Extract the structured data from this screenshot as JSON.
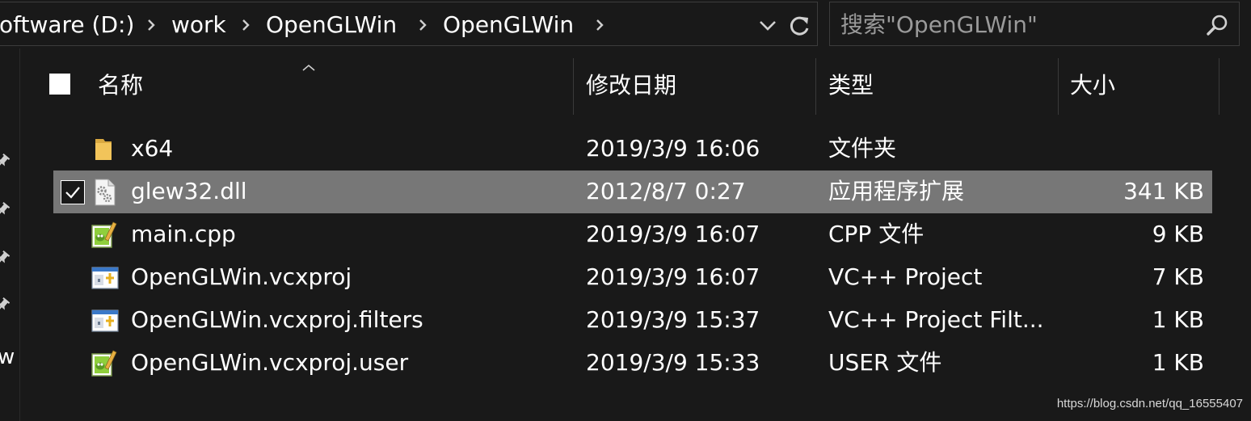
{
  "address_bar": {
    "breadcrumbs": [
      {
        "label": "oftware (D:)"
      },
      {
        "label": "work"
      },
      {
        "label": "OpenGLWin"
      },
      {
        "label": "OpenGLWin"
      }
    ],
    "dropdown_icon": "chevron-down-icon",
    "refresh_icon": "refresh-icon"
  },
  "search": {
    "placeholder": "搜索\"OpenGLWin\"",
    "icon": "search-icon"
  },
  "nav_pane": {
    "partial_label": "w",
    "pin_icons": [
      "pin-icon",
      "pin-icon",
      "pin-icon",
      "pin-icon"
    ]
  },
  "file_list": {
    "columns": {
      "name": "名称",
      "modified": "修改日期",
      "type": "类型",
      "size": "大小"
    },
    "sort_indicator": "sort-up-icon",
    "rows": [
      {
        "name": "x64",
        "modified": "2019/3/9 16:06",
        "type": "文件夹",
        "size": "",
        "icon": "folder-icon",
        "selected": false
      },
      {
        "name": "glew32.dll",
        "modified": "2012/8/7 0:27",
        "type": "应用程序扩展",
        "size": "341 KB",
        "icon": "dll-file-icon",
        "selected": true
      },
      {
        "name": "main.cpp",
        "modified": "2019/3/9 16:07",
        "type": "CPP 文件",
        "size": "9 KB",
        "icon": "notepadpp-file-icon",
        "selected": false
      },
      {
        "name": "OpenGLWin.vcxproj",
        "modified": "2019/3/9 16:07",
        "type": "VC++ Project",
        "size": "7 KB",
        "icon": "vcxproj-file-icon",
        "selected": false
      },
      {
        "name": "OpenGLWin.vcxproj.filters",
        "modified": "2019/3/9 15:37",
        "type": "VC++ Project Filt...",
        "size": "1 KB",
        "icon": "vcxproj-file-icon",
        "selected": false
      },
      {
        "name": "OpenGLWin.vcxproj.user",
        "modified": "2019/3/9 15:33",
        "type": "USER 文件",
        "size": "1 KB",
        "icon": "notepadpp-file-icon",
        "selected": false
      }
    ]
  },
  "watermark": "https://blog.csdn.net/qq_16555407",
  "colors": {
    "background": "#191919",
    "selected_row": "#777777",
    "text": "#ffffff",
    "placeholder": "#9a9a9a",
    "folder": "#f2c45a"
  }
}
